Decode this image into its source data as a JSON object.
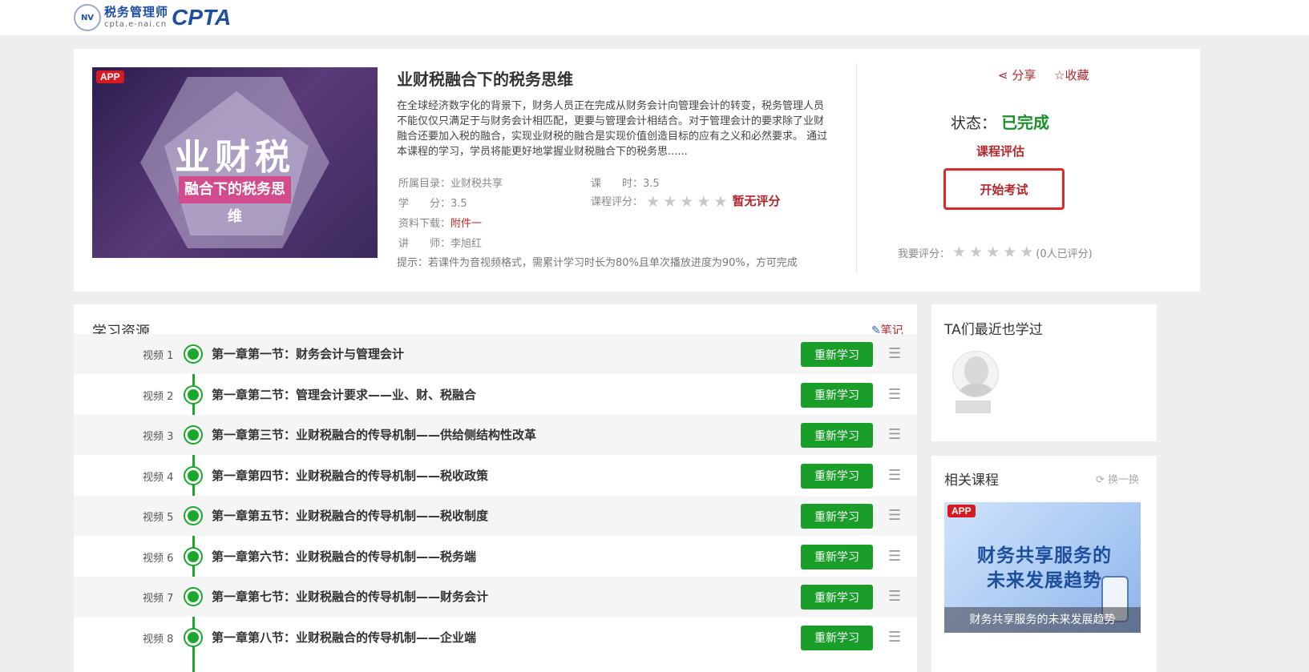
{
  "header": {
    "logo_seal": "NV",
    "logo_cn": "税务管理师",
    "logo_url": "cpta.e-nai.cn",
    "logo_en": "CPTA"
  },
  "course": {
    "cover_badge": "APP",
    "cover_title": "业财税",
    "cover_subtitle": "融合下的税务思维",
    "title": "业财税融合下的税务思维",
    "description": "在全球经济数字化的背景下，财务人员正在完成从财务会计向管理会计的转变，税务管理人员不能仅仅只满足于与财务会计相匹配，更要与管理会计相结合。对于管理会计的要求除了业财融合还要加入税的融合，实现业财税的融合是实现价值创造目标的应有之义和必然要求。 通过本课程的学习，学员将能更好地掌握业财税融合下的税务思......",
    "category_label": "所属目录：",
    "category_value": "业财税共享",
    "hours_label": "课　　时：",
    "hours_value": "3.5",
    "credit_label": "学　　分：",
    "credit_value": "3.5",
    "rating_label": "课程评分：",
    "rating_stars": 0,
    "rating_text": "暂无评分",
    "download_label": "资料下载：",
    "download_value": "附件一",
    "teacher_label": "讲　　师：",
    "teacher_value": "李旭红",
    "tip": "提示：若课件为音视频格式，需累计学习时长为80%且单次播放进度为90%，方可完成"
  },
  "actions": {
    "share": "分享",
    "collect": "收藏",
    "status_label": "状态：",
    "status_value": "已完成",
    "evaluate": "课程评估",
    "exam": "开始考试",
    "my_rating_label": "我要评分：",
    "my_rating_count": "(0人已评分)"
  },
  "resources": {
    "title": "学习资源",
    "notes": "笔记",
    "relearn_label": "重新学习",
    "items": [
      {
        "label": "视频 1",
        "title": "第一章第一节：财务会计与管理会计"
      },
      {
        "label": "视频 2",
        "title": "第一章第二节：管理会计要求——业、财、税融合"
      },
      {
        "label": "视频 3",
        "title": "第一章第三节：业财税融合的传导机制——供给侧结构性改革"
      },
      {
        "label": "视频 4",
        "title": "第一章第四节：业财税融合的传导机制——税收政策"
      },
      {
        "label": "视频 5",
        "title": "第一章第五节：业财税融合的传导机制——税收制度"
      },
      {
        "label": "视频 6",
        "title": "第一章第六节：业财税融合的传导机制——税务端"
      },
      {
        "label": "视频 7",
        "title": "第一章第七节：业财税融合的传导机制——财务会计"
      },
      {
        "label": "视频 8",
        "title": "第一章第八节：业财税融合的传导机制——企业端"
      }
    ]
  },
  "sidebar": {
    "ta_title": "TA们最近也学过",
    "related_title": "相关课程",
    "refresh": "换一换",
    "related_badge": "APP",
    "related_cover_text": "财务共享服务的未来发展趋势",
    "related_caption": "财务共享服务的未来发展趋势"
  },
  "colors": {
    "accent_red": "#b0262c",
    "success_green": "#1a9e2a",
    "brand_blue": "#1f4ea1"
  }
}
